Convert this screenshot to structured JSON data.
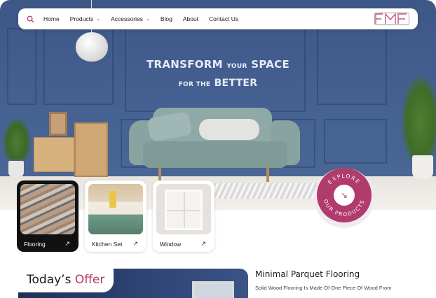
{
  "nav": {
    "items": [
      {
        "label": "Home",
        "dropdown": false
      },
      {
        "label": "Products",
        "dropdown": true
      },
      {
        "label": "Accessories",
        "dropdown": true
      },
      {
        "label": "Blog",
        "dropdown": false
      },
      {
        "label": "About",
        "dropdown": false
      },
      {
        "label": "Contact Us",
        "dropdown": false
      }
    ],
    "chevron": "⌄",
    "logo_text": "FMF"
  },
  "hero": {
    "line1_big_a": "TRANSFORM",
    "line1_small": "YOUR",
    "line1_big_b": "SPACE",
    "line2_small": "FOR THE",
    "line2_big": "BETTER"
  },
  "categories": [
    {
      "label": "Flooring",
      "arrow": "↗"
    },
    {
      "label": "Kitchen Set",
      "arrow": "↗"
    },
    {
      "label": "Window",
      "arrow": "↗"
    }
  ],
  "badge": {
    "text_top": "EXPLORE",
    "text_bottom": "OUR PRODUCTS",
    "arrow": "↘"
  },
  "offer": {
    "title_main": "Today’s",
    "title_accent": "Offer"
  },
  "product": {
    "title": "Minimal Parquet Flooring",
    "description": "Solid Wood Flooring Is Made Of One Piece Of Wood From"
  },
  "colors": {
    "accent": "#b03b6c",
    "hero_wall": "#3d5787",
    "dark_card": "#111111"
  },
  "icons": {
    "search": "search-icon",
    "arrow": "arrow-up-right-icon",
    "badge_arrow": "arrow-down-right-icon"
  }
}
